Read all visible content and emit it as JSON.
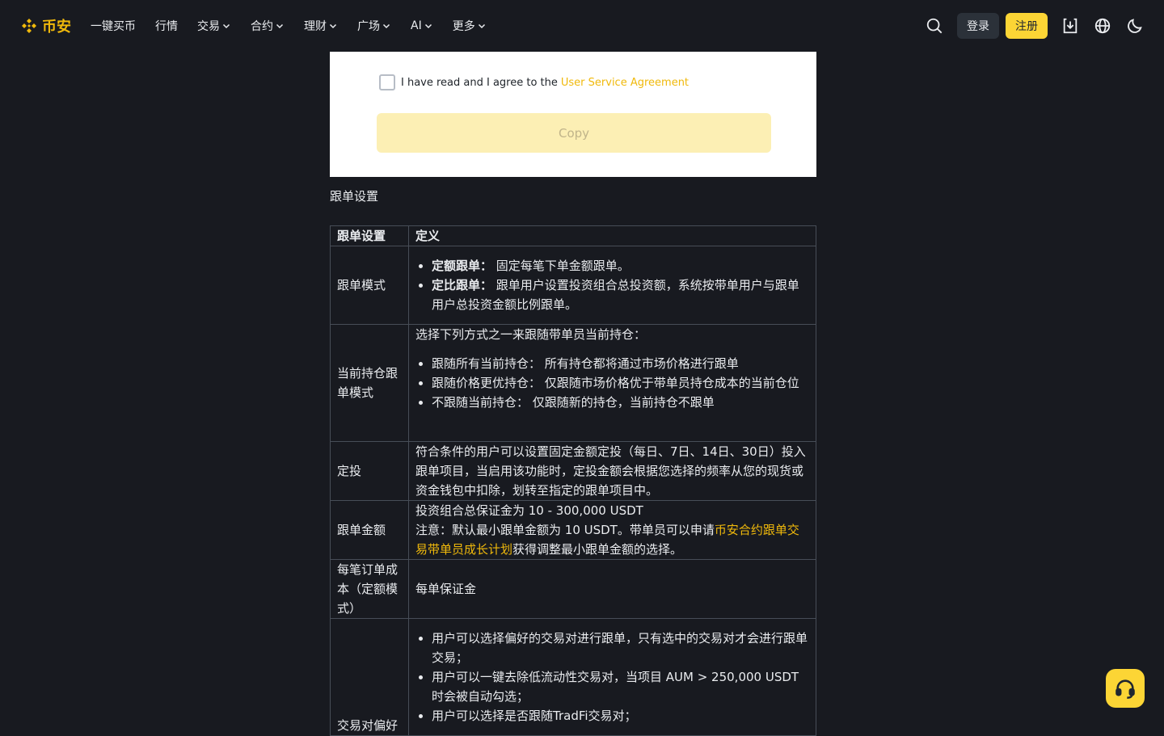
{
  "nav": {
    "logo": "币安",
    "items": [
      {
        "label": "一键买币",
        "dropdown": false
      },
      {
        "label": "行情",
        "dropdown": false
      },
      {
        "label": "交易",
        "dropdown": true
      },
      {
        "label": "合约",
        "dropdown": true
      },
      {
        "label": "理财",
        "dropdown": true
      },
      {
        "label": "广场",
        "dropdown": true
      },
      {
        "label": "AI",
        "dropdown": true
      },
      {
        "label": "更多",
        "dropdown": true
      }
    ],
    "login": "登录",
    "register": "注册"
  },
  "screenshot": {
    "agree_prefix": "I have read and I agree to the",
    "agree_link": "User Service Agreement",
    "copy_button": "Copy"
  },
  "section_title": "跟单设置",
  "table": {
    "headers": [
      "跟单设置",
      "定义"
    ],
    "rows": {
      "mode": {
        "name": "跟单模式",
        "item1_bold": "定额跟单：",
        "item1_text": "固定每笔下单金额跟单。",
        "item2_bold": "定比跟单：",
        "item2_text": "跟单用户设置投资组合总投资额，系统按带单用户与跟单用户总投资金额比例跟单。"
      },
      "position": {
        "name": "当前持仓跟单模式",
        "intro": "选择下列方式之一来跟随带单员当前持仓：",
        "items": [
          "跟随所有当前持仓： 所有持仓都将通过市场价格进行跟单",
          "跟随价格更优持仓： 仅跟随市场价格优于带单员持仓成本的当前仓位",
          "不跟随当前持仓： 仅跟随新的持仓，当前持仓不跟单"
        ]
      },
      "dca": {
        "name": "定投",
        "text": "符合条件的用户可以设置固定金额定投（每日、7日、14日、30日）投入跟单项目，当启用该功能时，定投金额会根据您选择的频率从您的现货或资金钱包中扣除，划转至指定的跟单项目中。"
      },
      "amount": {
        "name": "跟单金额",
        "line1": "投资组合总保证金为 10 - 300,000 USDT",
        "line2_prefix": "注意：默认最小跟单金额为 10 USDT。带单员可以申请",
        "line2_link": "币安合约跟单交易带单员成长计划",
        "line2_suffix": "获得调整最小跟单金额的选择。"
      },
      "cost": {
        "name": "每笔订单成本（定额模式）",
        "text": "每单保证金"
      },
      "pairs": {
        "name": "交易对偏好",
        "items": [
          "用户可以选择偏好的交易对进行跟单，只有选中的交易对才会进行跟单交易；",
          "用户可以一键去除低流动性交易对，当项目 AUM > 250,000 USDT 时会被自动勾选；",
          "用户可以选择是否跟随TradFi交易对；"
        ]
      }
    }
  },
  "colors": {
    "brand": "#f0b90b",
    "background": "#181a20",
    "register_bg": "#fcd535"
  }
}
